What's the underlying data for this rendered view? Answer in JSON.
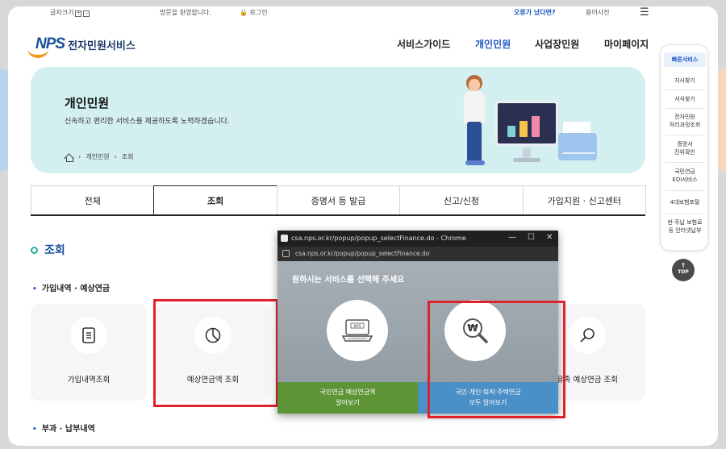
{
  "util": {
    "font_size": "글자크기",
    "font_plus": "+",
    "font_minus": "−",
    "welcome": "방문을 환영합니다.",
    "login": "로그인",
    "error": "오류가 났다면?",
    "dictionary": "용어사전",
    "menu_icon": "☰"
  },
  "header": {
    "logo_text": "NPS",
    "service_name": "전자민원서비스",
    "nav": [
      "서비스가이드",
      "개인민원",
      "사업장민원",
      "마이페이지"
    ]
  },
  "banner": {
    "title": "개인민원",
    "subtitle": "신속하고 편리한 서비스를 제공하도록 노력하겠습니다.",
    "breadcrumb": [
      "개인민원",
      "조회"
    ]
  },
  "quick_menu": {
    "items": [
      "빠른서비스",
      "지사찾기",
      "서식찾기",
      "전자민원\n처리과정조회",
      "증명서\n진위확인",
      "국민연금\nEDI서비스",
      "4대보험포털",
      "반·주납 보험료\n등 인터넷납부"
    ],
    "top": "TOP"
  },
  "tabs": [
    "전체",
    "조회",
    "증명서 등 발급",
    "신고/신청",
    "가입지원 · 신고센터"
  ],
  "content": {
    "section_title": "조회",
    "sub1": "가입내역 · 예상연금",
    "sub2": "부과 · 납부내역",
    "cards": [
      "가입내역조회",
      "예상연금액 조회",
      "유족 예상연금 조회"
    ]
  },
  "popup": {
    "window_title": "csa.nps.or.kr/popup/popup_selectFinance.do - Chrome",
    "url": "csa.nps.or.kr/popup/popup_selectFinance.do",
    "heading": "원하시는 서비스를 선택해 주세요",
    "option1": "국민연금 예상연금액\n알아보기",
    "option2": "국민·개인·퇴직·주택연금\n모두 알아보기",
    "laptop_label": "NPS",
    "coin_symbol": "₩",
    "minimize": "—",
    "maximize": "☐",
    "close": "✕"
  },
  "colors": {
    "accent_blue": "#1f57c3",
    "banner_bg": "#d4efef",
    "highlight_red": "#e0222b",
    "popup_green": "#5c9436",
    "popup_blue": "#4a8fc6"
  }
}
